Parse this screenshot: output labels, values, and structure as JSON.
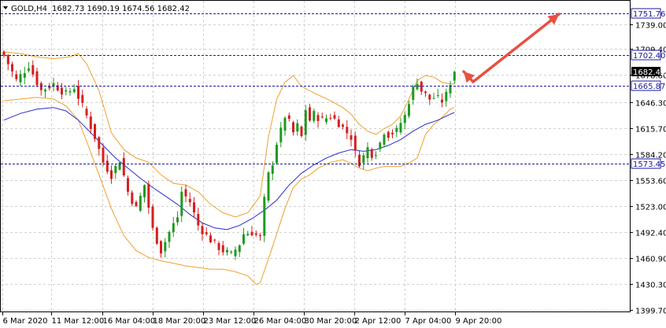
{
  "header": {
    "symbol_label": "GOLD,H4",
    "ohlc": "1682.73 1690.19 1674.56 1682.42"
  },
  "colors": {
    "background": "#ffffff",
    "bull_candle": "#1f9a1f",
    "bear_candle": "#d42020",
    "bollinger": "#f0a030",
    "moving_average": "#2a2ad0",
    "level_line": "#1a1aa0",
    "arrow": "#e85040",
    "grid": "#d0d0d0"
  },
  "chart_data": {
    "type": "candlestick",
    "title": "GOLD,H4",
    "ylim": [
      1385,
      1790
    ],
    "y_ticks": [
      "1739.00",
      "1709.40",
      "1678.80",
      "1646.30",
      "1615.70",
      "1584.20",
      "1553.60",
      "1523.00",
      "1492.40",
      "1460.90",
      "1430.30",
      "1399.70"
    ],
    "x_ticks": [
      "6 Mar 2020",
      "11 Mar 12:00",
      "16 Mar 04:00",
      "18 Mar 20:00",
      "23 Mar 12:00",
      "26 Mar 04:00",
      "30 Mar 20:00",
      "2 Apr 12:00",
      "7 Apr 04:00",
      "9 Apr 20:00"
    ],
    "levels": [
      {
        "value": 1751.76,
        "label": "1751.76",
        "style": "dashed"
      },
      {
        "value": 1702.4,
        "label": "1702.40",
        "style": "dashed"
      },
      {
        "value": 1665.87,
        "label": "1665.87",
        "style": "dashed"
      },
      {
        "value": 1573.45,
        "label": "1573.45",
        "style": "dashed"
      }
    ],
    "current_price": {
      "value": 1682.42,
      "label": "1682.42"
    },
    "grid": true,
    "indicators": [
      "Bollinger Bands",
      "Moving Average"
    ],
    "close_path": [
      [
        0,
        1702
      ],
      [
        3,
        1672
      ],
      [
        6,
        1690
      ],
      [
        9,
        1660
      ],
      [
        12,
        1668
      ],
      [
        15,
        1656
      ],
      [
        17,
        1664
      ],
      [
        20,
        1630
      ],
      [
        22,
        1605
      ],
      [
        24,
        1575
      ],
      [
        26,
        1560
      ],
      [
        28,
        1578
      ],
      [
        30,
        1540
      ],
      [
        32,
        1520
      ],
      [
        34,
        1548
      ],
      [
        36,
        1495
      ],
      [
        38,
        1470
      ],
      [
        40,
        1492
      ],
      [
        42,
        1510
      ],
      [
        43,
        1540
      ],
      [
        45,
        1528
      ],
      [
        47,
        1500
      ],
      [
        49,
        1488
      ],
      [
        51,
        1478
      ],
      [
        53,
        1470
      ],
      [
        55,
        1465
      ],
      [
        57,
        1478
      ],
      [
        58,
        1490
      ],
      [
        60,
        1492
      ],
      [
        62,
        1485
      ],
      [
        63,
        1530
      ],
      [
        64,
        1560
      ],
      [
        65,
        1575
      ],
      [
        66,
        1598
      ],
      [
        67,
        1612
      ],
      [
        68,
        1630
      ],
      [
        69,
        1622
      ],
      [
        70,
        1610
      ],
      [
        71,
        1618
      ],
      [
        72,
        1605
      ],
      [
        73,
        1638
      ],
      [
        74,
        1625
      ],
      [
        75,
        1632
      ],
      [
        77,
        1625
      ],
      [
        79,
        1630
      ],
      [
        81,
        1622
      ],
      [
        83,
        1610
      ],
      [
        84,
        1605
      ],
      [
        85,
        1585
      ],
      [
        86,
        1575
      ],
      [
        87,
        1582
      ],
      [
        88,
        1592
      ],
      [
        89,
        1585
      ],
      [
        90,
        1588
      ],
      [
        91,
        1598
      ],
      [
        92,
        1612
      ],
      [
        93,
        1608
      ],
      [
        95,
        1612
      ],
      [
        96,
        1622
      ],
      [
        97,
        1630
      ],
      [
        98,
        1648
      ],
      [
        99,
        1662
      ],
      [
        100,
        1672
      ],
      [
        101,
        1660
      ],
      [
        102,
        1655
      ],
      [
        103,
        1650
      ],
      [
        104,
        1652
      ],
      [
        105,
        1650
      ],
      [
        106,
        1648
      ],
      [
        107,
        1655
      ],
      [
        108,
        1670
      ],
      [
        109,
        1682.42
      ]
    ],
    "bb_upper": [
      [
        0,
        1706
      ],
      [
        4,
        1704
      ],
      [
        8,
        1700
      ],
      [
        12,
        1698
      ],
      [
        16,
        1700
      ],
      [
        18,
        1704
      ],
      [
        20,
        1692
      ],
      [
        23,
        1660
      ],
      [
        26,
        1610
      ],
      [
        29,
        1590
      ],
      [
        32,
        1580
      ],
      [
        35,
        1575
      ],
      [
        38,
        1560
      ],
      [
        41,
        1550
      ],
      [
        44,
        1548
      ],
      [
        47,
        1540
      ],
      [
        50,
        1525
      ],
      [
        53,
        1515
      ],
      [
        56,
        1510
      ],
      [
        59,
        1515
      ],
      [
        62,
        1535
      ],
      [
        64,
        1605
      ],
      [
        66,
        1650
      ],
      [
        68,
        1670
      ],
      [
        70,
        1678
      ],
      [
        72,
        1665
      ],
      [
        74,
        1660
      ],
      [
        76,
        1655
      ],
      [
        79,
        1648
      ],
      [
        82,
        1640
      ],
      [
        84,
        1632
      ],
      [
        86,
        1620
      ],
      [
        88,
        1612
      ],
      [
        90,
        1608
      ],
      [
        92,
        1615
      ],
      [
        94,
        1620
      ],
      [
        96,
        1630
      ],
      [
        98,
        1650
      ],
      [
        100,
        1672
      ],
      [
        102,
        1678
      ],
      [
        104,
        1676
      ],
      [
        106,
        1670
      ],
      [
        108,
        1668
      ],
      [
        109,
        1668
      ]
    ],
    "bb_lower": [
      [
        0,
        1648
      ],
      [
        4,
        1650
      ],
      [
        8,
        1652
      ],
      [
        12,
        1650
      ],
      [
        15,
        1642
      ],
      [
        18,
        1625
      ],
      [
        20,
        1600
      ],
      [
        23,
        1560
      ],
      [
        26,
        1520
      ],
      [
        29,
        1488
      ],
      [
        32,
        1470
      ],
      [
        35,
        1462
      ],
      [
        38,
        1458
      ],
      [
        41,
        1455
      ],
      [
        44,
        1452
      ],
      [
        47,
        1450
      ],
      [
        50,
        1448
      ],
      [
        53,
        1448
      ],
      [
        56,
        1445
      ],
      [
        59,
        1440
      ],
      [
        61,
        1430
      ],
      [
        62,
        1432
      ],
      [
        64,
        1460
      ],
      [
        66,
        1490
      ],
      [
        68,
        1520
      ],
      [
        70,
        1545
      ],
      [
        72,
        1555
      ],
      [
        74,
        1560
      ],
      [
        76,
        1568
      ],
      [
        79,
        1575
      ],
      [
        82,
        1578
      ],
      [
        84,
        1574
      ],
      [
        86,
        1568
      ],
      [
        88,
        1565
      ],
      [
        90,
        1568
      ],
      [
        92,
        1570
      ],
      [
        94,
        1570
      ],
      [
        96,
        1570
      ],
      [
        98,
        1574
      ],
      [
        100,
        1580
      ],
      [
        102,
        1608
      ],
      [
        104,
        1620
      ],
      [
        106,
        1628
      ],
      [
        108,
        1638
      ],
      [
        109,
        1640
      ]
    ],
    "ma": [
      [
        0,
        1625
      ],
      [
        4,
        1633
      ],
      [
        8,
        1638
      ],
      [
        12,
        1640
      ],
      [
        15,
        1636
      ],
      [
        18,
        1625
      ],
      [
        21,
        1610
      ],
      [
        24,
        1595
      ],
      [
        27,
        1580
      ],
      [
        30,
        1568
      ],
      [
        33,
        1556
      ],
      [
        36,
        1545
      ],
      [
        39,
        1535
      ],
      [
        42,
        1525
      ],
      [
        45,
        1513
      ],
      [
        48,
        1503
      ],
      [
        51,
        1497
      ],
      [
        54,
        1495
      ],
      [
        57,
        1500
      ],
      [
        60,
        1508
      ],
      [
        63,
        1518
      ],
      [
        66,
        1530
      ],
      [
        69,
        1548
      ],
      [
        72,
        1562
      ],
      [
        75,
        1572
      ],
      [
        78,
        1580
      ],
      [
        81,
        1586
      ],
      [
        84,
        1590
      ],
      [
        87,
        1588
      ],
      [
        90,
        1590
      ],
      [
        93,
        1595
      ],
      [
        96,
        1602
      ],
      [
        99,
        1612
      ],
      [
        102,
        1620
      ],
      [
        105,
        1625
      ],
      [
        108,
        1632
      ],
      [
        109,
        1634
      ]
    ]
  }
}
